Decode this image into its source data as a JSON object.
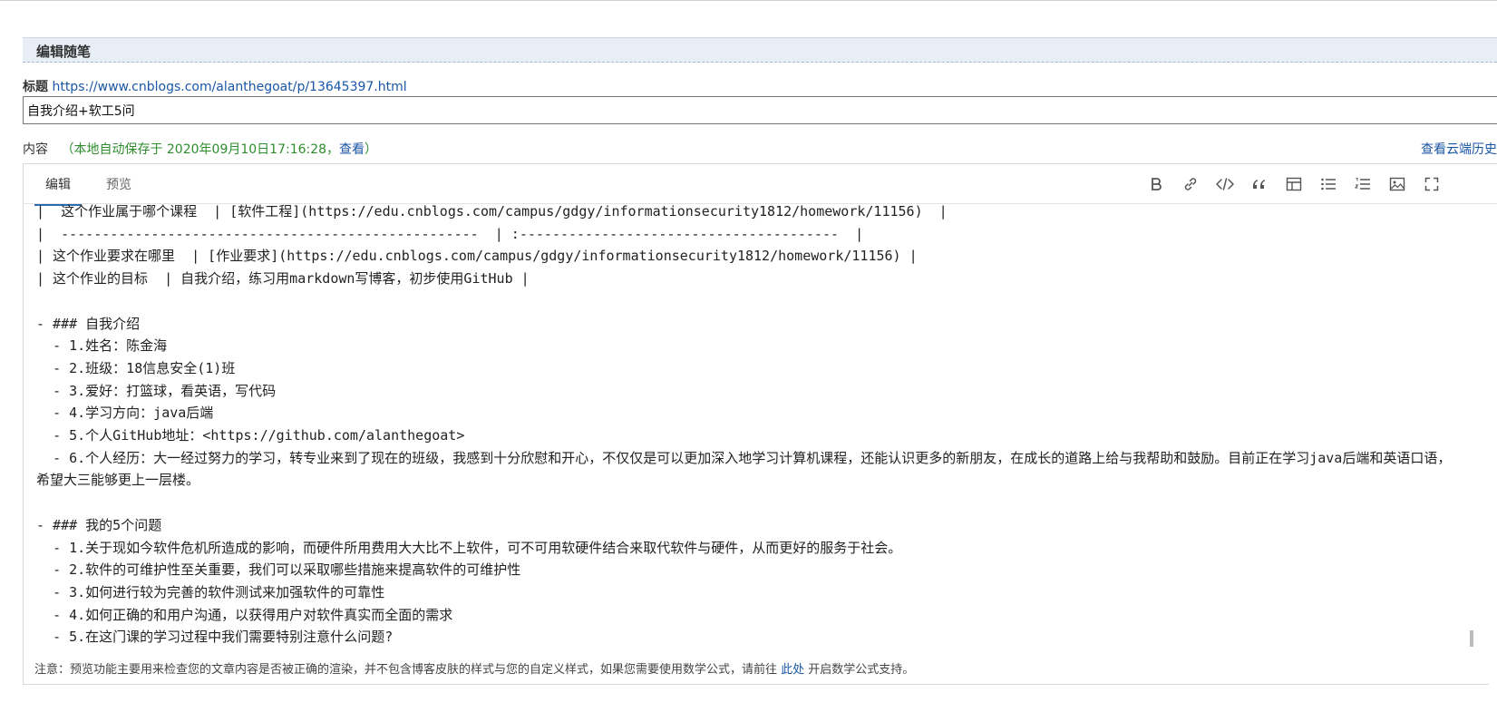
{
  "panel": {
    "title": "编辑随笔"
  },
  "title_field": {
    "label": "标题",
    "url": "https://www.cnblogs.com/alanthegoat/p/13645397.html",
    "value": "自我介绍+软工5问"
  },
  "content_field": {
    "label": "内容",
    "autosave_prefix": "（本地自动保存于 2020年09月10日17:16:28，",
    "autosave_view_link": "查看",
    "autosave_suffix": "）",
    "cloud_history_link": "查看云端历史"
  },
  "editor": {
    "tabs": [
      {
        "label": "编辑",
        "active": true
      },
      {
        "label": "预览",
        "active": false
      }
    ],
    "toolbar_icons": [
      "bold-icon",
      "link-icon",
      "code-icon",
      "quote-icon",
      "table-icon",
      "unordered-list-icon",
      "ordered-list-icon",
      "image-icon",
      "fullscreen-icon"
    ],
    "lines": [
      "|  这个作业属于哪个课程  | [软件工程](https://edu.cnblogs.com/campus/gdgy/informationsecurity1812/homework/11156)  |",
      "|  ---------------------------------------------------  | :---------------------------------------  |",
      "| 这个作业要求在哪里  | [作业要求](https://edu.cnblogs.com/campus/gdgy/informationsecurity1812/homework/11156) |",
      "| 这个作业的目标  | 自我介绍，练习用markdown写博客，初步使用GitHub |",
      "",
      "- ### 自我介绍",
      "  - 1.姓名：陈金海",
      "  - 2.班级：18信息安全(1)班",
      "  - 3.爱好：打篮球，看英语，写代码",
      "  - 4.学习方向：java后端",
      "  - 5.个人GitHub地址：<https://github.com/alanthegoat>",
      "  - 6.个人经历：大一经过努力的学习，转专业来到了现在的班级，我感到十分欣慰和开心，不仅仅是可以更加深入地学习计算机课程，还能认识更多的新朋友，在成长的道路上给与我帮助和鼓励。目前正在学习java后端和英语口语，希望大三能够更上一层楼。",
      "",
      "- ### 我的5个问题",
      "  - 1.关于现如今软件危机所造成的影响，而硬件所用费用大大比不上软件，可不可用软硬件结合来取代软件与硬件，从而更好的服务于社会。",
      "  - 2.软件的可维护性至关重要，我们可以采取哪些措施来提高软件的可维护性",
      "  - 3.如何进行较为完善的软件测试来加强软件的可靠性",
      "  - 4.如何正确的和用户沟通，以获得用户对软件真实而全面的需求",
      "  - 5.在这门课的学习过程中我们需要特别注意什么问题?"
    ]
  },
  "note": {
    "text_before": "注意：预览功能主要用来检查您的文章内容是否被正确的渲染，并不包含博客皮肤的样式与您的自定义样式，如果您需要使用数学公式，请前往 ",
    "link": "此处",
    "text_after": " 开启数学公式支持。"
  }
}
